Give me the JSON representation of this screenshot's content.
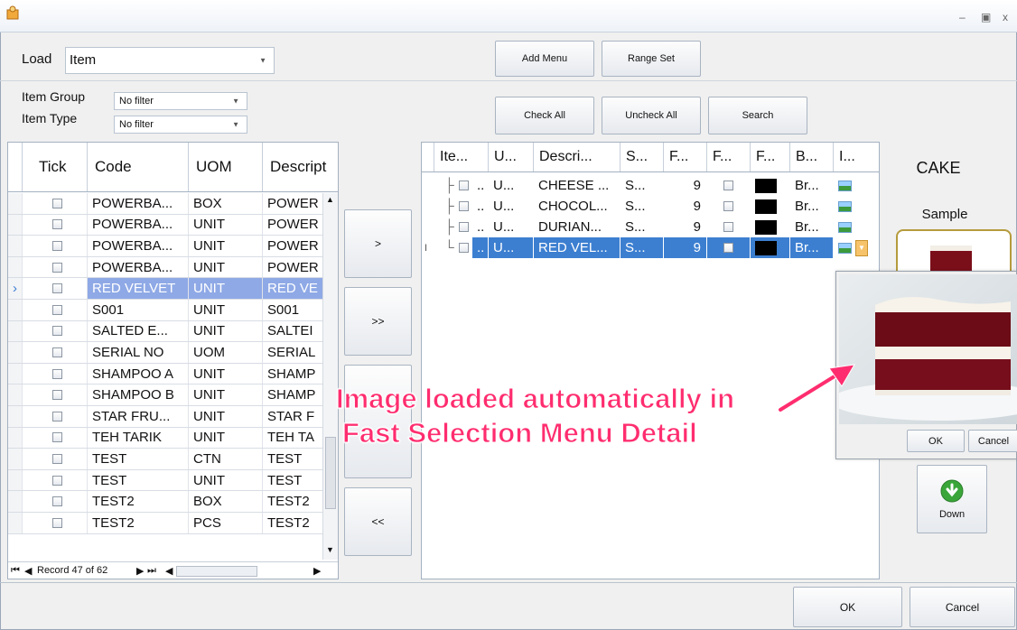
{
  "load": {
    "label": "Load",
    "value": "Item"
  },
  "filters": [
    {
      "label": "Item Group",
      "value": "No filter"
    },
    {
      "label": "Item Type",
      "value": "No filter"
    }
  ],
  "toolbar": {
    "add_menu": "Add Menu",
    "range_set": "Range Set",
    "check_all": "Check All",
    "uncheck_all": "Uncheck All",
    "search": "Search"
  },
  "left_grid": {
    "columns": [
      "Tick",
      "Code",
      "UOM",
      "Descript"
    ],
    "rows": [
      {
        "code": "POWERBA...",
        "uom": "BOX",
        "desc": "POWER"
      },
      {
        "code": "POWERBA...",
        "uom": "UNIT",
        "desc": "POWER"
      },
      {
        "code": "POWERBA...",
        "uom": "UNIT",
        "desc": "POWER"
      },
      {
        "code": "POWERBA...",
        "uom": "UNIT",
        "desc": "POWER"
      },
      {
        "code": "RED VELVET",
        "uom": "UNIT",
        "desc": "RED VE"
      },
      {
        "code": "S001",
        "uom": "UNIT",
        "desc": "S001"
      },
      {
        "code": "SALTED E...",
        "uom": "UNIT",
        "desc": "SALTEI"
      },
      {
        "code": "SERIAL NO",
        "uom": "UOM",
        "desc": "SERIAL"
      },
      {
        "code": "SHAMPOO A",
        "uom": "UNIT",
        "desc": "SHAMP"
      },
      {
        "code": "SHAMPOO B",
        "uom": "UNIT",
        "desc": "SHAMP"
      },
      {
        "code": "STAR FRU...",
        "uom": "UNIT",
        "desc": "STAR F"
      },
      {
        "code": "TEH TARIK",
        "uom": "UNIT",
        "desc": "TEH TA"
      },
      {
        "code": "TEST",
        "uom": "CTN",
        "desc": "TEST"
      },
      {
        "code": "TEST",
        "uom": "UNIT",
        "desc": "TEST"
      },
      {
        "code": "TEST2",
        "uom": "BOX",
        "desc": "TEST2"
      },
      {
        "code": "TEST2",
        "uom": "PCS",
        "desc": "TEST2"
      }
    ],
    "record": "Record 47 of 62"
  },
  "move_buttons": [
    ">",
    ">>",
    "<<"
  ],
  "right_grid": {
    "columns": [
      "Ite...",
      "U...",
      "Descri...",
      "S...",
      "F...",
      "F...",
      "F...",
      "B...",
      "I..."
    ],
    "rows": [
      {
        "dots": "..",
        "u": "U...",
        "desc": "CHEESE ...",
        "s": "S...",
        "f": "9",
        "b": "Br..."
      },
      {
        "dots": "..",
        "u": "U...",
        "desc": "CHOCOL...",
        "s": "S...",
        "f": "9",
        "b": "Br..."
      },
      {
        "dots": "..",
        "u": "U...",
        "desc": "DURIAN...",
        "s": "S...",
        "f": "9",
        "b": "Br..."
      },
      {
        "dots": "..",
        "u": "U...",
        "desc": "RED VEL...",
        "s": "S...",
        "f": "9",
        "b": "Br..."
      }
    ],
    "cursor": "I"
  },
  "preview": {
    "category": "CAKE",
    "sample_label": "Sample",
    "down_label": "Down"
  },
  "popup": {
    "ok": "OK",
    "cancel": "Cancel"
  },
  "annotation": {
    "line1": "Image loaded automatically in",
    "line2": "Fast Selection Menu Detail"
  },
  "footer": {
    "ok": "OK",
    "cancel": "Cancel"
  },
  "colors": {
    "selection": "#3c7fd1",
    "left_selection": "#8fa9e6",
    "annotation": "#ff2d6f"
  }
}
